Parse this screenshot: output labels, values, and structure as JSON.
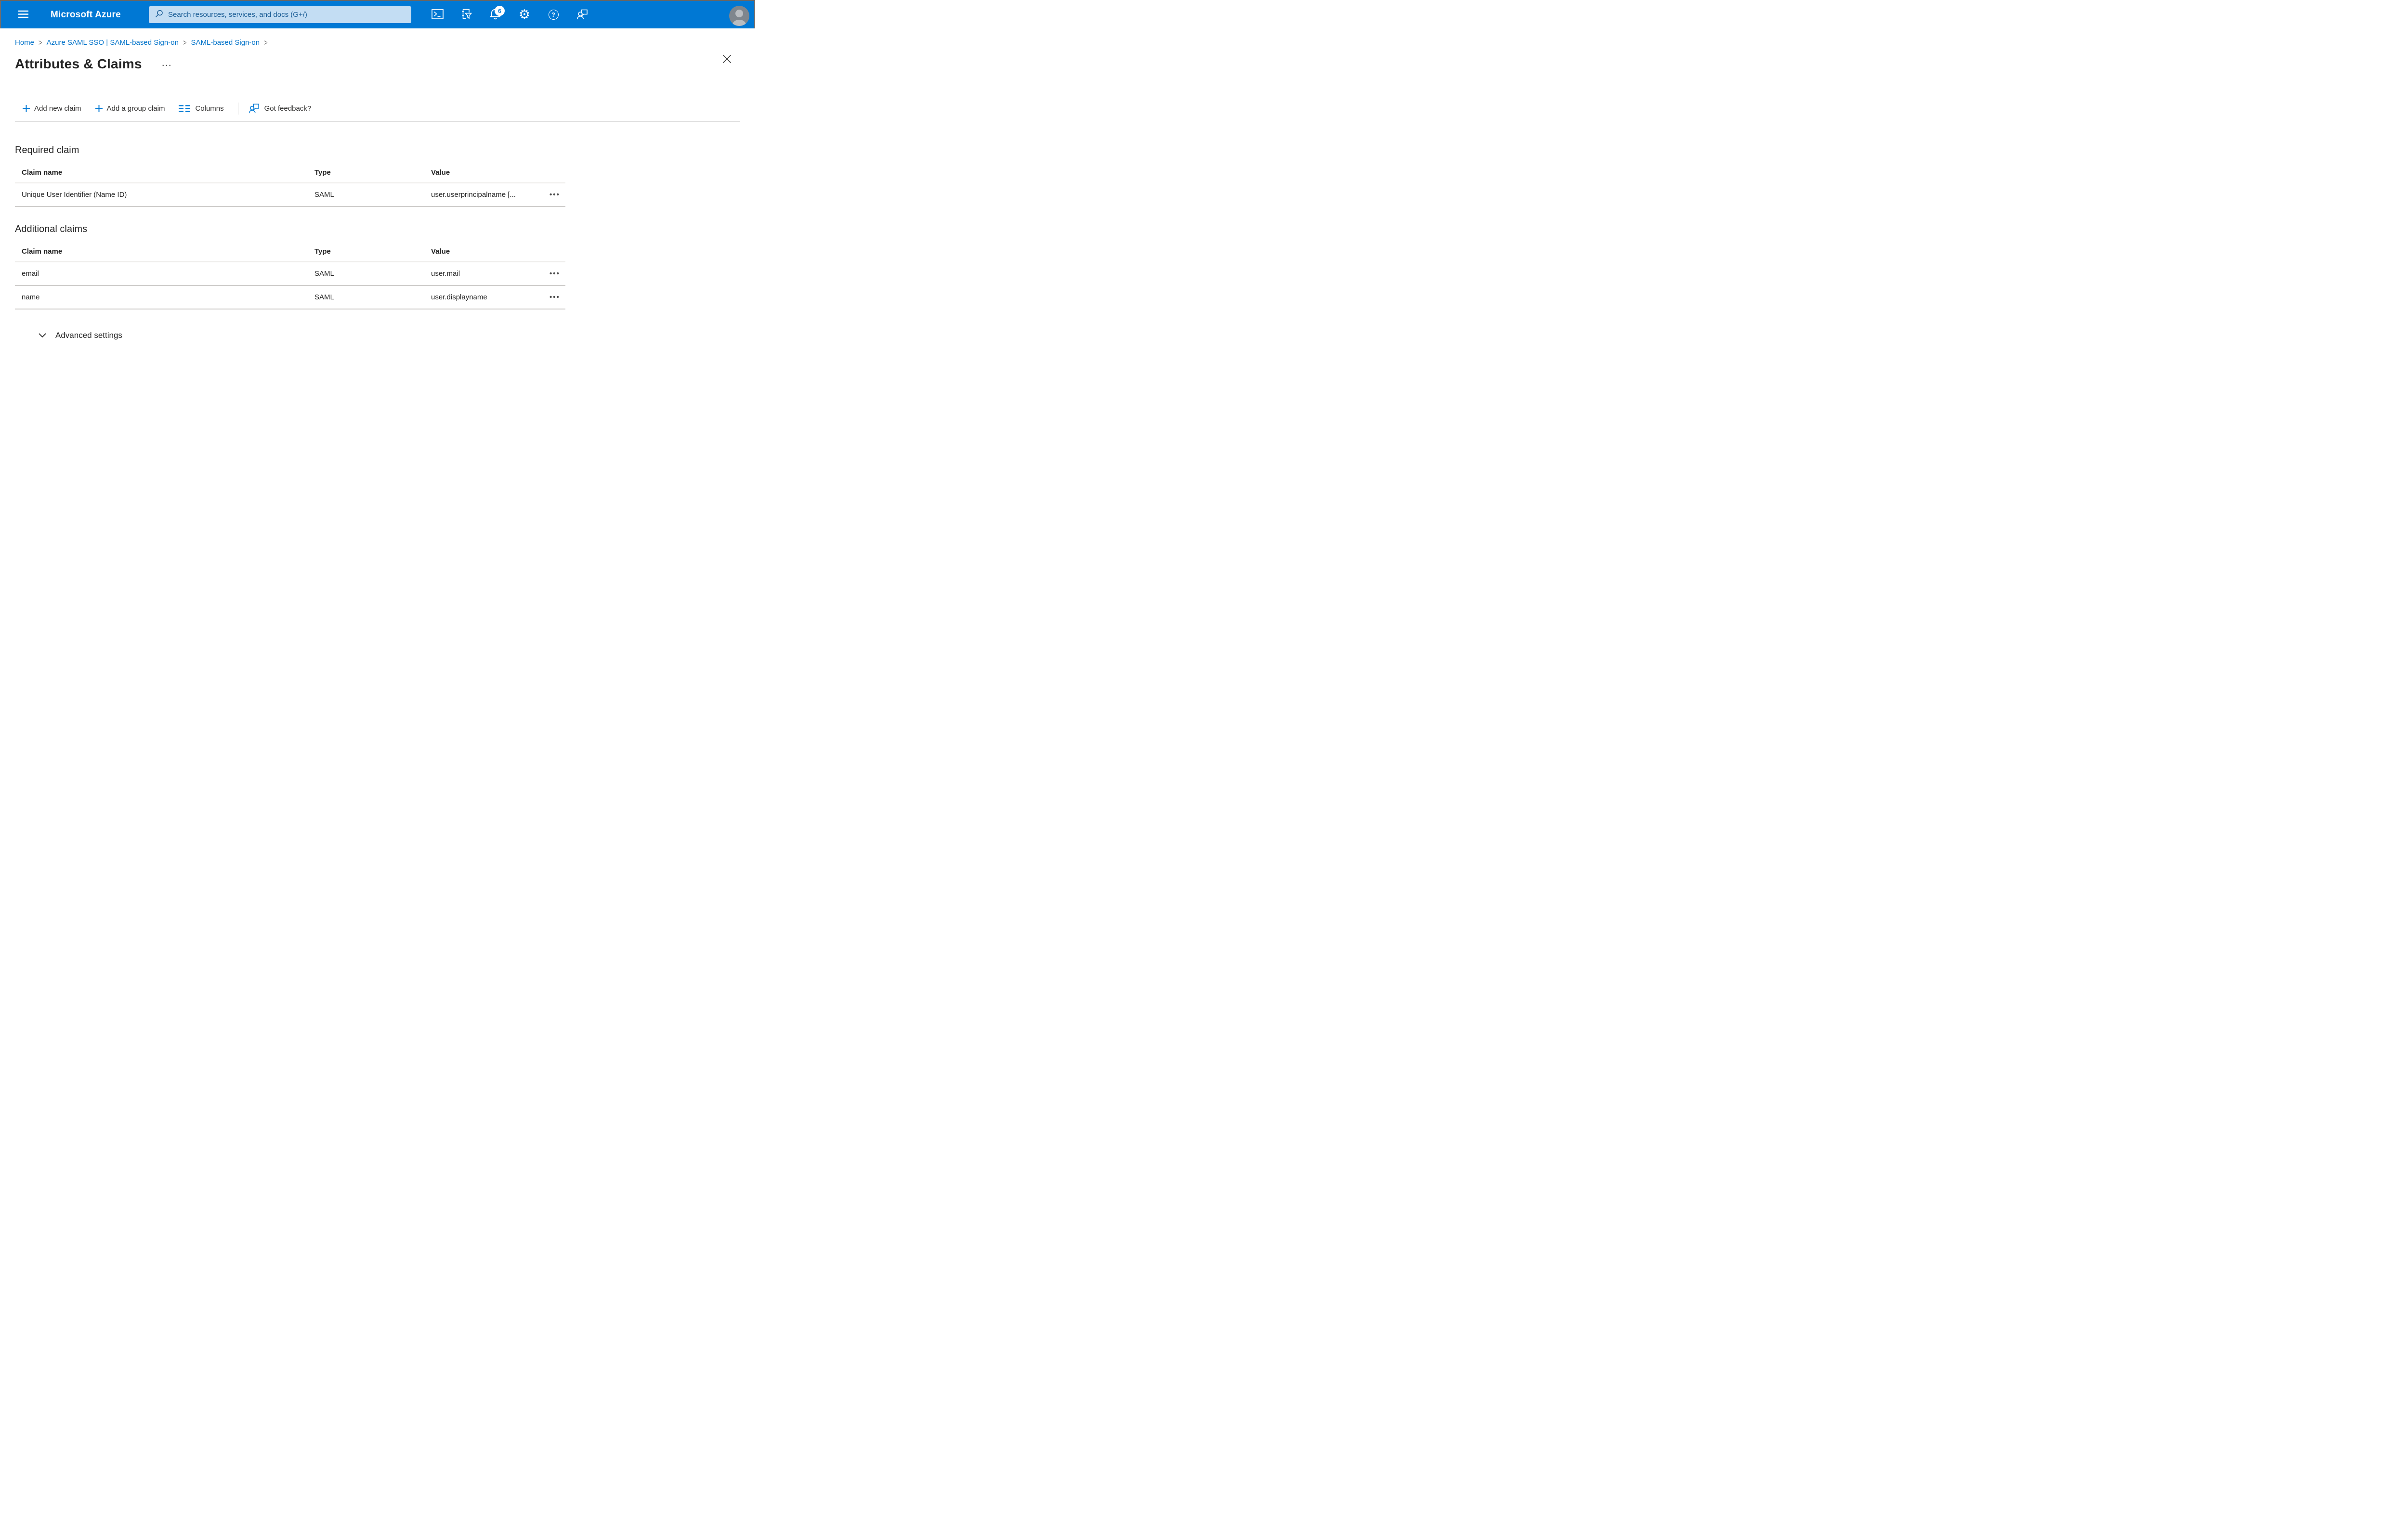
{
  "colors": {
    "header_bg": "#0078d4",
    "search_bg": "#c3ddf3",
    "search_text": "#175a93",
    "link_blue": "#0072c9",
    "text_dark": "#242424",
    "accent_blue": "#0078d4",
    "row_border": "#cfcdcb"
  },
  "topbar": {
    "product_name": "Microsoft Azure",
    "search_placeholder": "Search resources, services, and docs (G+/)",
    "notification_badge": "6",
    "help_glyph": "?",
    "gear_glyph": "⚙",
    "icons": [
      "hamburger-menu-icon",
      "search-icon",
      "cloud-shell-icon",
      "directory-filter-icon",
      "notifications-bell-icon",
      "settings-gear-icon",
      "help-icon",
      "feedback-icon",
      "avatar"
    ]
  },
  "breadcrumb": {
    "separator": ">",
    "items": [
      {
        "label": "Home"
      },
      {
        "label": "Azure SAML SSO | SAML-based Sign-on"
      },
      {
        "label": "SAML-based Sign-on"
      }
    ]
  },
  "page": {
    "title": "Attributes & Claims",
    "more_menu": "···"
  },
  "toolbar": {
    "add_new_claim": "Add new claim",
    "add_group_claim": "Add a group claim",
    "columns": "Columns",
    "feedback": "Got feedback?"
  },
  "sections": [
    {
      "heading": "Required claim",
      "columns": [
        "Claim name",
        "Type",
        "Value"
      ],
      "rows": [
        {
          "claim_name": "Unique User Identifier (Name ID)",
          "type": "SAML",
          "value": "user.userprincipalname [...",
          "menu": "•••"
        }
      ]
    },
    {
      "heading": "Additional claims",
      "columns": [
        "Claim name",
        "Type",
        "Value"
      ],
      "rows": [
        {
          "claim_name": "email",
          "type": "SAML",
          "value": "user.mail",
          "menu": "•••"
        },
        {
          "claim_name": "name",
          "type": "SAML",
          "value": "user.displayname",
          "menu": "•••"
        }
      ]
    }
  ],
  "advanced_settings": {
    "label": "Advanced settings"
  }
}
